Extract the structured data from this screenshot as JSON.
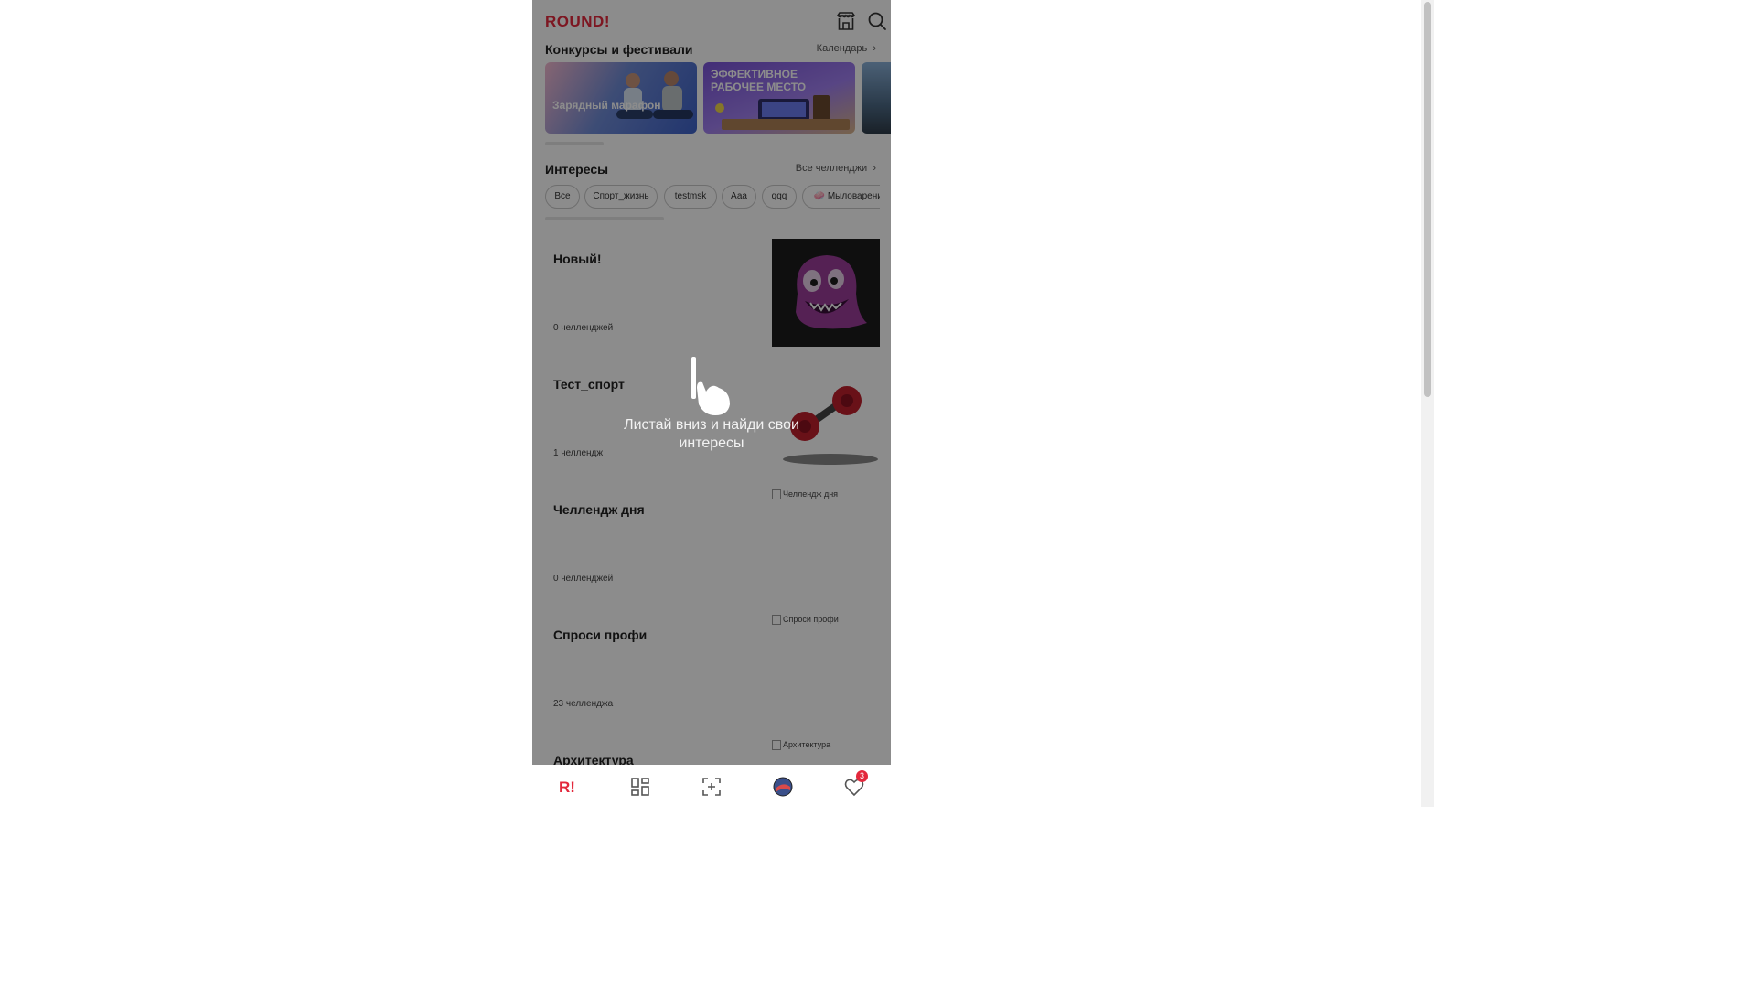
{
  "header": {
    "logo": "ROUND!",
    "store_icon": "store-icon",
    "search_icon": "search-icon"
  },
  "contests": {
    "title": "Конкурсы и фестивали",
    "link": "Календарь",
    "banners": [
      {
        "text": "Зарядный марафон"
      },
      {
        "text": "ЭФФЕКТИВНОЕ РАБОЧЕЕ МЕСТО"
      },
      {
        "text": ""
      }
    ]
  },
  "interests": {
    "title": "Интересы",
    "link": "Все челленджи",
    "chips": [
      "Все",
      "Спорт_жизнь",
      "testmsk",
      "Ааа",
      "qqq",
      "🧼 Мыловарение"
    ]
  },
  "cards": [
    {
      "title": "Новый!",
      "count": "0 челленджей",
      "image_alt": ""
    },
    {
      "title": "Тест_спорт",
      "count": "1 челлендж",
      "image_alt": ""
    },
    {
      "title": "Челлендж дня",
      "count": "0 челленджей",
      "image_alt": "Челлендж дня"
    },
    {
      "title": "Спроси профи",
      "count": "23 челленджа",
      "image_alt": "Спроси профи"
    },
    {
      "title": "Архитектура",
      "count": "",
      "image_alt": "Архитектура"
    }
  ],
  "overlay": {
    "hint": "Листай вниз и найди свои интересы",
    "hand_icon": "hand-swipe-icon"
  },
  "bottom_nav": {
    "items": [
      "home-icon",
      "catalog-icon",
      "scan-icon",
      "profile-avatar",
      "favorites-icon"
    ],
    "favorites_badge": "3"
  },
  "colors": {
    "brand": "#e3283c"
  }
}
